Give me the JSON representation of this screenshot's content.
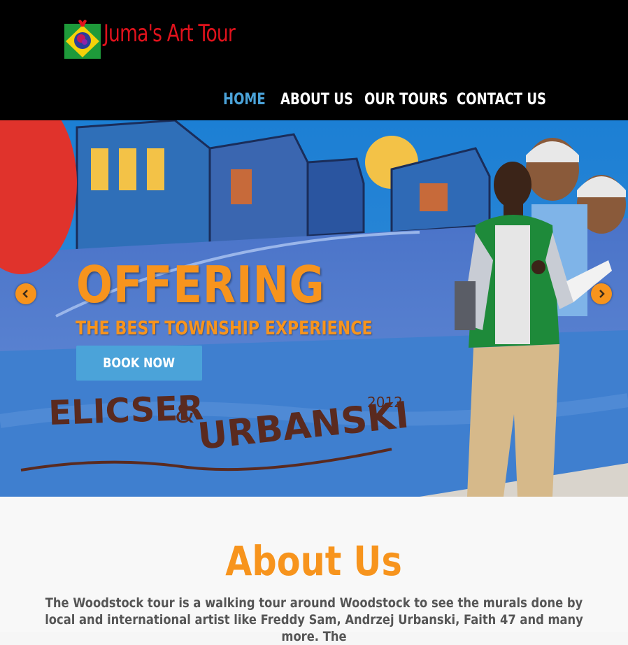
{
  "brand": {
    "name": "Juma's Art Tour"
  },
  "nav": {
    "items": [
      {
        "label": "HOME",
        "active": true
      },
      {
        "label": "ABOUT US",
        "active": false
      },
      {
        "label": "OUR TOURS",
        "active": false
      },
      {
        "label": "CONTACT US",
        "active": false
      }
    ]
  },
  "hero": {
    "heading": "OFFERING",
    "subheading": "THE BEST TOWNSHIP EXPERIENCE",
    "button_label": "BOOK NOW",
    "mural_text": "ELICSER & URBANSKI 2012",
    "prev_icon": "chevron-left-icon",
    "next_icon": "chevron-right-icon"
  },
  "about": {
    "title": "About Us",
    "text": "The Woodstock tour is a walking tour around Woodstock to see the murals done by local and international artist like Freddy Sam, Andrzej Urbanski, Faith 47 and many more. The"
  },
  "colors": {
    "accent_orange": "#f7941d",
    "nav_active": "#4ba3d9",
    "button_blue": "#4ba3d9",
    "logo_red": "#e0121c"
  }
}
